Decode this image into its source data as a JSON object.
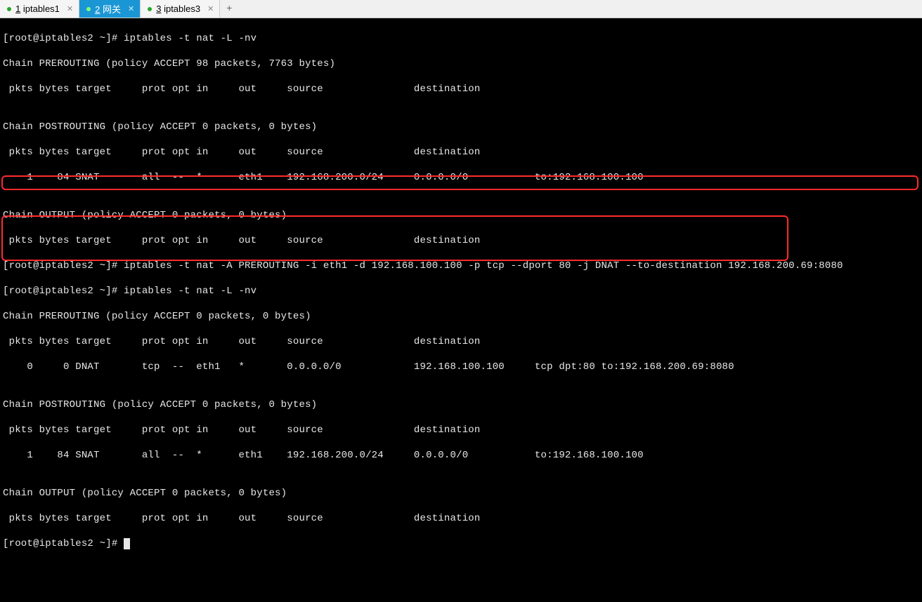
{
  "tabs": [
    {
      "num": "1",
      "label": "iptables1"
    },
    {
      "num": "2",
      "label": "网关"
    },
    {
      "num": "3",
      "label": "iptables3"
    }
  ],
  "activeTabIndex": 1,
  "term": {
    "l1": "[root@iptables2 ~]# iptables -t nat -L -nv",
    "l2": "Chain PREROUTING (policy ACCEPT 98 packets, 7763 bytes)",
    "l3": " pkts bytes target     prot opt in     out     source               destination",
    "l4": "",
    "l5": "Chain POSTROUTING (policy ACCEPT 0 packets, 0 bytes)",
    "l6": " pkts bytes target     prot opt in     out     source               destination",
    "l7": "    1    84 SNAT       all  --  *      eth1    192.168.200.0/24     0.0.0.0/0           to:192.168.100.100",
    "l8": "",
    "l9": "Chain OUTPUT (policy ACCEPT 0 packets, 0 bytes)",
    "l10": " pkts bytes target     prot opt in     out     source               destination",
    "l11": "[root@iptables2 ~]# iptables -t nat -A PREROUTING -i eth1 -d 192.168.100.100 -p tcp --dport 80 -j DNAT --to-destination 192.168.200.69:8080",
    "l12": "[root@iptables2 ~]# iptables -t nat -L -nv",
    "l13": "Chain PREROUTING (policy ACCEPT 0 packets, 0 bytes)",
    "l14": " pkts bytes target     prot opt in     out     source               destination",
    "l15": "    0     0 DNAT       tcp  --  eth1   *       0.0.0.0/0            192.168.100.100     tcp dpt:80 to:192.168.200.69:8080",
    "l16": "",
    "l17": "Chain POSTROUTING (policy ACCEPT 0 packets, 0 bytes)",
    "l18": " pkts bytes target     prot opt in     out     source               destination",
    "l19": "    1    84 SNAT       all  --  *      eth1    192.168.200.0/24     0.0.0.0/0           to:192.168.100.100",
    "l20": "",
    "l21": "Chain OUTPUT (policy ACCEPT 0 packets, 0 bytes)",
    "l22": " pkts bytes target     prot opt in     out     source               destination",
    "l23": "[root@iptables2 ~]# "
  }
}
